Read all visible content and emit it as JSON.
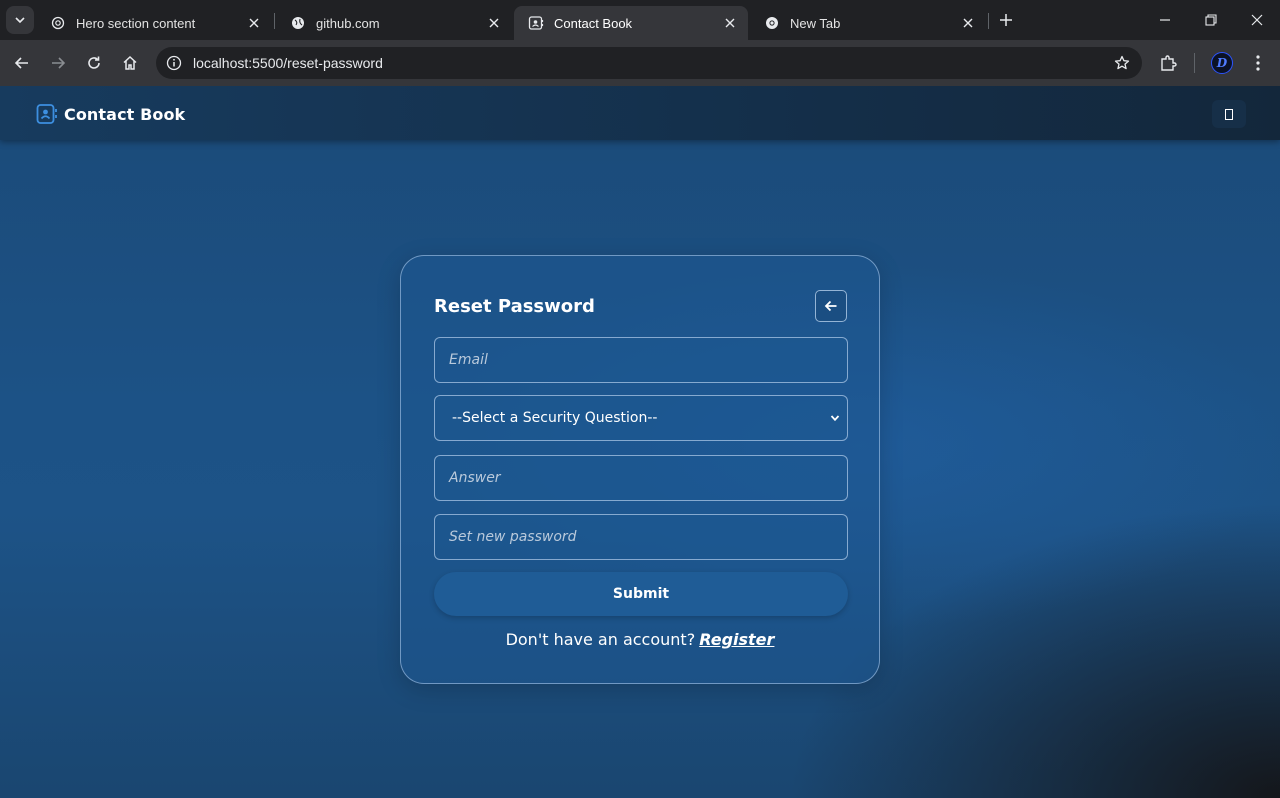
{
  "browser": {
    "tabs": [
      {
        "title": "Hero section content",
        "icon": "chatgpt-icon",
        "active": false
      },
      {
        "title": "github.com",
        "icon": "globe-icon",
        "active": false
      },
      {
        "title": "Contact Book",
        "icon": "contact-book-icon",
        "active": true
      },
      {
        "title": "New Tab",
        "icon": "chrome-icon",
        "active": false
      }
    ],
    "address": "localhost:5500/reset-password",
    "profile_initial": "D"
  },
  "app": {
    "brand_name": "Contact Book",
    "accent_color": "#1f5c96"
  },
  "form": {
    "title": "Reset Password",
    "email_placeholder": "Email",
    "security_question_selected": "--Select a Security Question--",
    "answer_placeholder": "Answer",
    "new_password_placeholder": "Set new password",
    "submit_label": "Submit",
    "footer_text": "Don't have an account?",
    "register_link": "Register"
  }
}
